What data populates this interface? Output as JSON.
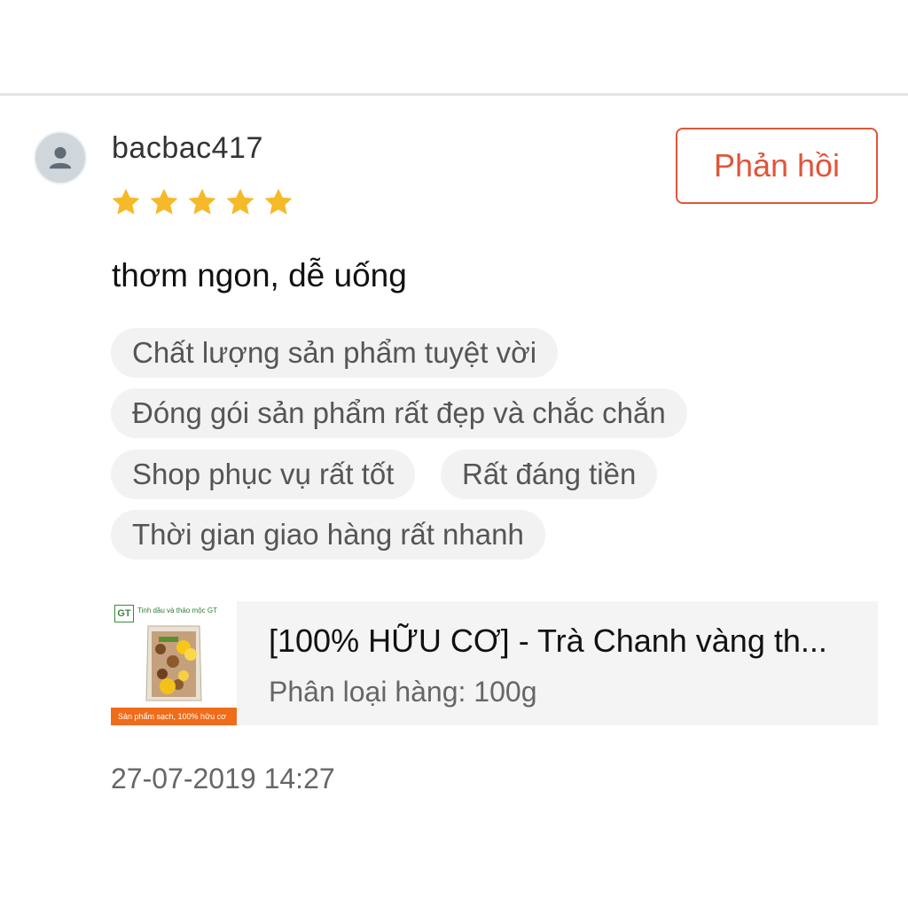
{
  "review": {
    "username": "bacbac417",
    "rating": 5,
    "rating_max": 5,
    "reply_label": "Phản hồi",
    "comment": "thơm ngon, dễ uống",
    "tags": [
      "Chất lượng sản phẩm tuyệt vời",
      "Đóng gói sản phẩm rất đẹp và chắc chắn",
      "Shop phục vụ rất tốt",
      "Rất đáng tiền",
      "Thời gian giao hàng rất nhanh"
    ],
    "product": {
      "name": "[100% HỮU CƠ] - Trà Chanh vàng th...",
      "variant": "Phân loại hàng: 100g",
      "thumb_logo": "GT",
      "thumb_brand": "Tinh dầu và thảo mộc GT",
      "thumb_banner": "Sản phẩm sạch, 100% hữu cơ"
    },
    "timestamp": "27-07-2019 14:27"
  },
  "colors": {
    "accent": "#e0553a",
    "star": "#f6b928",
    "tag_bg": "#f2f2f2",
    "product_bg": "#f4f4f4"
  },
  "icons": {
    "avatar": "user-avatar-icon",
    "star": "star-icon"
  }
}
